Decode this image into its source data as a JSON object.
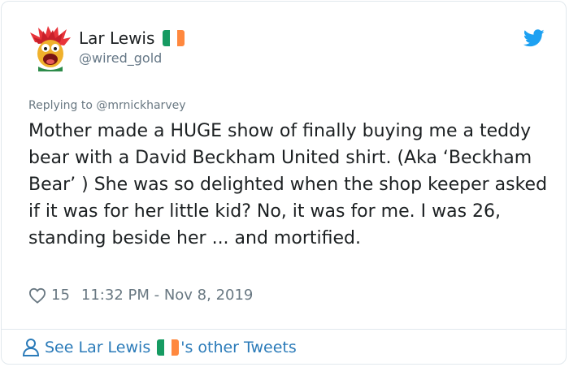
{
  "tweet": {
    "author_name": "Lar Lewis",
    "author_handle": "@wired_gold",
    "replying_prefix": "Replying to",
    "replying_to": "@mrnickharvey",
    "text": "Mother made a HUGE show of finally buying me a teddy bear with a David Beckham United shirt. (Aka ‘Beckham Bear’ ) She was so delighted when the shop keeper asked if it was for her little kid? No, it was for me. I was 26, standing beside her ... and mortified.",
    "likes": "15",
    "timestamp": "11:32 PM - Nov 8, 2019"
  },
  "footer": {
    "prefix": "See Lar Lewis",
    "suffix": "'s other Tweets"
  },
  "icons": {
    "avatar": "muppet-avatar",
    "flag": "ireland-flag-icon",
    "brand": "twitter-bird-icon",
    "like": "heart-icon",
    "profile": "person-icon"
  },
  "colors": {
    "accent": "#1da1f2",
    "link": "#2b7bb9",
    "muted": "#697882",
    "flag_green": "#169b62",
    "flag_white": "#ffffff",
    "flag_orange": "#ff883e"
  }
}
